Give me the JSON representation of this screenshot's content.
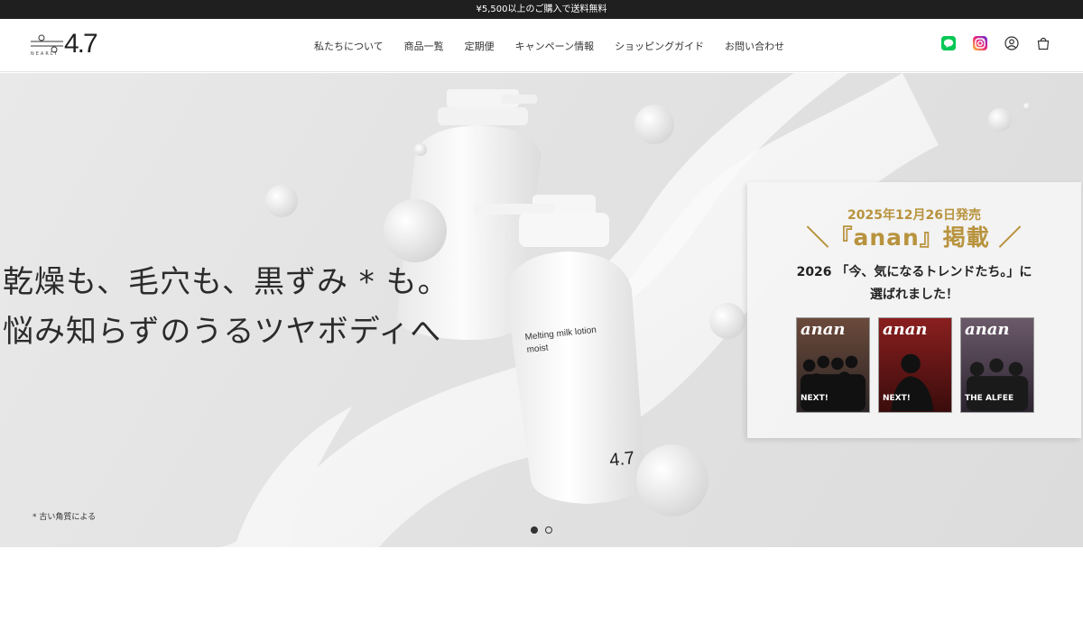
{
  "announcement": "¥5,500以上のご購入で送料無料",
  "header": {
    "logo": {
      "number": "4.7",
      "wordmark": "NEARLY"
    },
    "nav": [
      "私たちについて",
      "商品一覧",
      "定期便",
      "キャンペーン情報",
      "ショッピングガイド",
      "お問い合わせ"
    ],
    "icons": [
      "line-icon",
      "instagram-icon",
      "account-icon",
      "cart-icon"
    ]
  },
  "hero": {
    "headline_line1": "乾燥も、毛穴も、黒ずみ * も。",
    "headline_line2": "悩み知らずのうるツヤボディへ",
    "product_label_line1": "Melting milk lotion",
    "product_label_line2": "moist",
    "product_brand": "4.7",
    "footnote": "* 古い角質による",
    "slides": {
      "count": 2,
      "active": 1
    }
  },
  "card": {
    "date": "2025年12月26日発売",
    "magazine": "＼『anan』掲載 ／",
    "body_line1": "2026 「今、気になるトレンドたち。」に",
    "body_line2": "選ばれました！",
    "covers": [
      {
        "title": "anan",
        "subtitle": "NEXT!"
      },
      {
        "title": "anan",
        "subtitle": "NEXT!"
      },
      {
        "title": "anan",
        "subtitle": "THE ALFEE"
      }
    ]
  },
  "colors": {
    "gold": "#b8933e",
    "topbar": "#1f1f1f",
    "line_green": "#06c755"
  }
}
